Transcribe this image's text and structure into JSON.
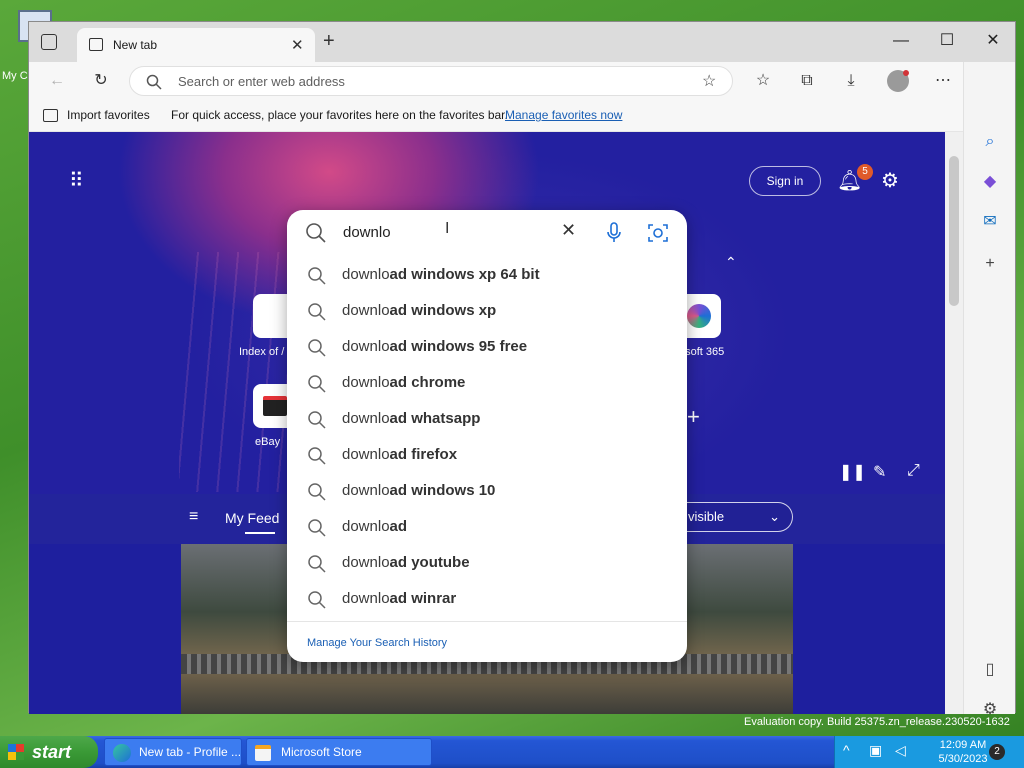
{
  "desktop": {
    "icon_label": "My C"
  },
  "browser": {
    "tab_title": "New tab",
    "tab_close": "✕",
    "new_tab": "+",
    "address_placeholder": "Search or enter web address",
    "favbar": {
      "import_label": "Import favorites",
      "message": "For quick access, place your favorites here on the favorites bar.",
      "manage_link": "Manage favorites now"
    }
  },
  "newtab": {
    "sign_in": "Sign in",
    "notifications_count": "5",
    "search_query": "downlo",
    "suggestions": [
      {
        "typed": "downlo",
        "rest": "ad windows xp 64 bit"
      },
      {
        "typed": "downlo",
        "rest": "ad windows xp"
      },
      {
        "typed": "downlo",
        "rest": "ad windows 95 free"
      },
      {
        "typed": "downlo",
        "rest": "ad chrome"
      },
      {
        "typed": "downlo",
        "rest": "ad whatsapp"
      },
      {
        "typed": "downlo",
        "rest": "ad firefox"
      },
      {
        "typed": "downlo",
        "rest": "ad windows 10"
      },
      {
        "typed": "downlo",
        "rest": "ad"
      },
      {
        "typed": "downlo",
        "rest": "ad youtube"
      },
      {
        "typed": "downlo",
        "rest": "ad winrar"
      }
    ],
    "manage_history": "Manage Your Search History",
    "quick_links": [
      {
        "label": "Index of /"
      },
      {
        "label": "eBay"
      },
      {
        "label": "osoft 365"
      }
    ],
    "feed_tab": "My Feed",
    "visible_dropdown": "visible"
  },
  "watermark": {
    "build": "Evaluation copy. Build 25375.zn_release.230520-1632"
  },
  "taskbar": {
    "start": "start",
    "items": [
      {
        "label": "New tab - Profile ..."
      },
      {
        "label": "Microsoft Store"
      }
    ],
    "time": "12:09 AM",
    "date": "5/30/2023",
    "notif_count": "2"
  }
}
